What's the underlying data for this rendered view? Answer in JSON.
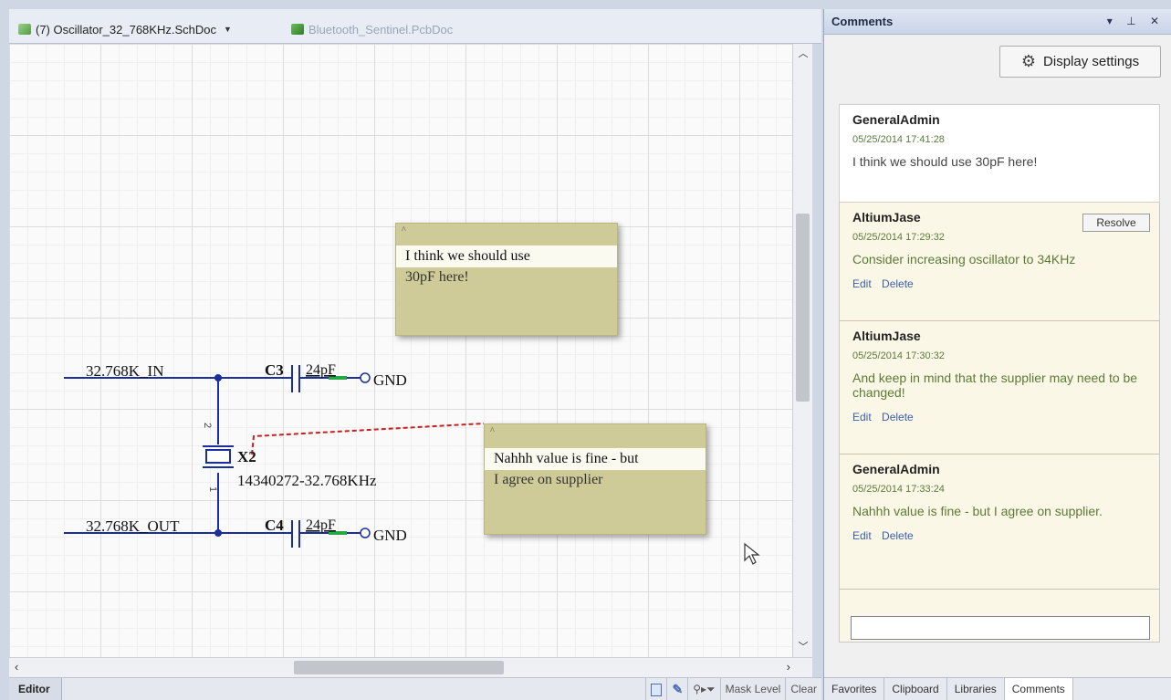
{
  "doc_tabs": {
    "active": "(7) Oscillator_32_768KHz.SchDoc",
    "inactive": "Bluetooth_Sentinel.PcbDoc"
  },
  "schematic": {
    "net_in": "32.768K_IN",
    "net_out": "32.768K_OUT",
    "c3_designator": "C3",
    "c3_value": "24pF",
    "c4_designator": "C4",
    "c4_value": "24pF",
    "gnd_label": "GND",
    "x2_designator": "X2",
    "x2_part": "14340272-32.768KHz",
    "pin2": "2",
    "pin1": "1"
  },
  "notes": [
    {
      "line1": "I think we should use",
      "line2": "30pF here!"
    },
    {
      "line1": "Nahhh value is fine - but",
      "line2": "I agree on supplier"
    }
  ],
  "statusbar": {
    "editor": "Editor",
    "mask_level": "Mask Level",
    "clear": "Clear"
  },
  "panel": {
    "title": "Comments",
    "controls": "▾ ⊥ ✕",
    "display_settings": "Display settings",
    "comments": [
      {
        "author": "GeneralAdmin",
        "date": "05/25/2014 17:41:28",
        "text": "I think we should use 30pF here!"
      },
      {
        "author": "AltiumJase",
        "date": "05/25/2014 17:29:32",
        "text": "Consider increasing oscillator to 34KHz",
        "resolve": "Resolve",
        "edit": "Edit",
        "delete": "Delete"
      },
      {
        "author": "AltiumJase",
        "date": "05/25/2014 17:30:32",
        "text": "And keep in mind that the supplier may need to be changed!",
        "edit": "Edit",
        "delete": "Delete"
      },
      {
        "author": "GeneralAdmin",
        "date": "05/25/2014 17:33:24",
        "text": "Nahhh value is fine - but I agree on supplier.",
        "edit": "Edit",
        "delete": "Delete"
      }
    ],
    "tabs": [
      "Favorites",
      "Clipboard",
      "Libraries",
      "Comments"
    ]
  },
  "colors": {
    "wire": "#1a2f9c",
    "note_bg": "#cfcb98",
    "comment_green": "#5b7a35",
    "link_blue": "#3a5fb0"
  }
}
